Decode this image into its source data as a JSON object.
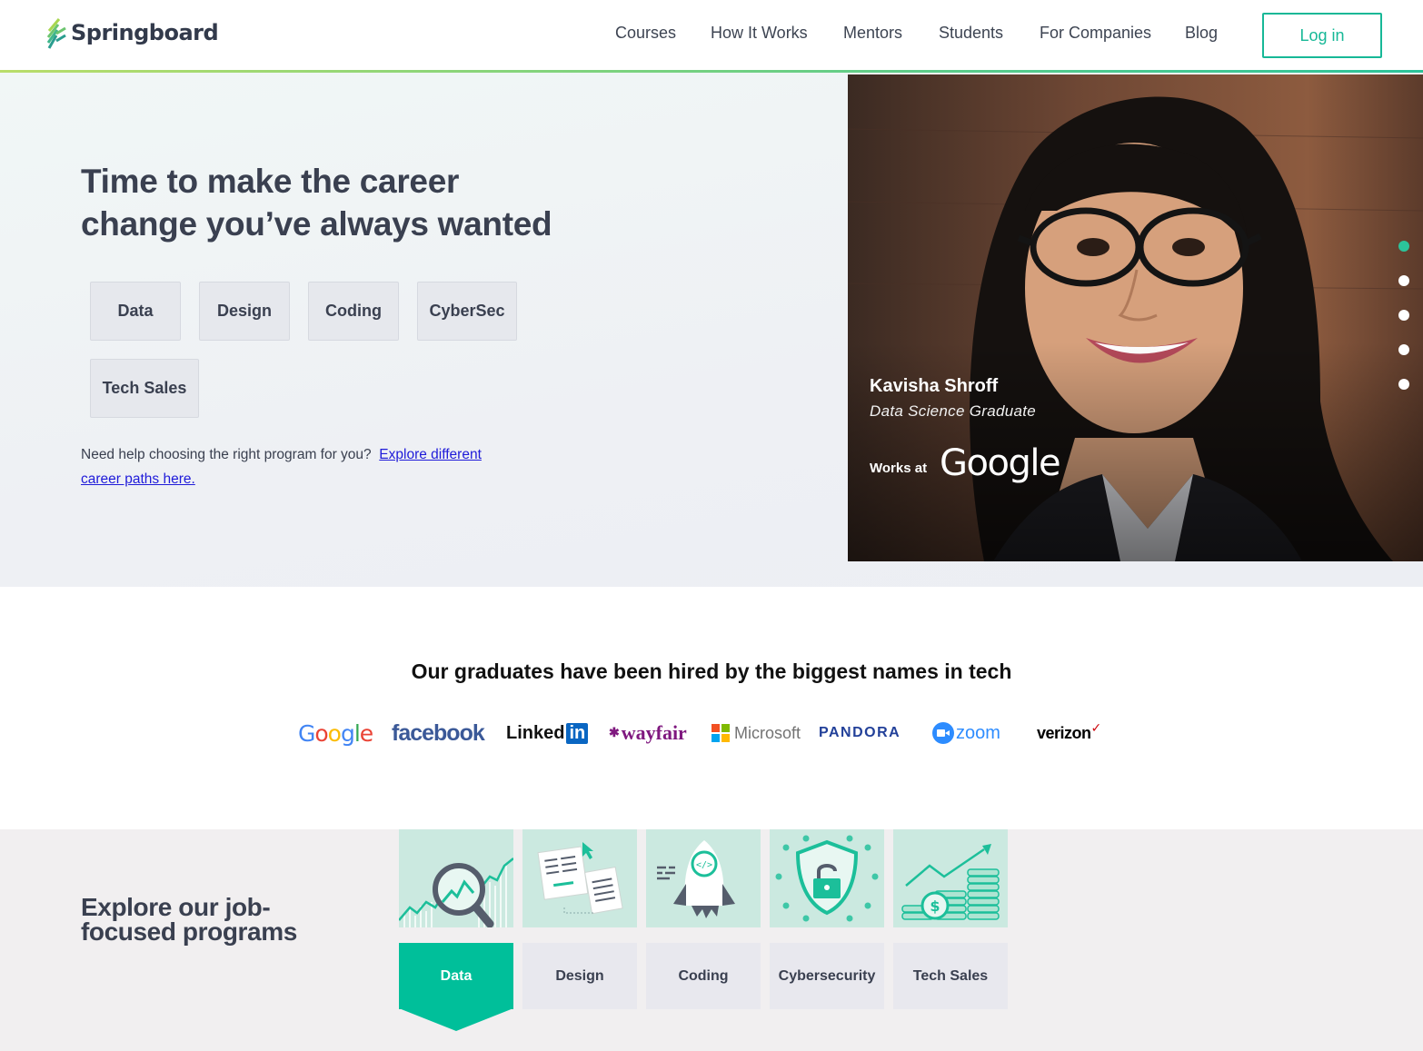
{
  "brand": {
    "name": "Springboard",
    "accent": "#17b897",
    "tab_active": "#00bf9a"
  },
  "nav": {
    "items": [
      "Courses",
      "How It Works",
      "Mentors",
      "Students",
      "For Companies",
      "Blog"
    ],
    "login_label": "Log in"
  },
  "hero": {
    "title": "Time to make the career change you’ve always wanted",
    "categories": [
      "Data",
      "Design",
      "Coding",
      "CyberSec",
      "Tech Sales"
    ],
    "help_text": "Need help choosing the right program for you?",
    "help_link": "Explore different career paths here."
  },
  "testimonial": {
    "name": "Kavisha Shroff",
    "role": "Data Science Graduate",
    "works_at_label": "Works at",
    "company": "Google",
    "slide_count": 5,
    "active_slide": 1
  },
  "hired": {
    "title": "Our graduates have been hired by the biggest names in tech",
    "companies": [
      "Google",
      "facebook",
      "LinkedIn",
      "wayfair",
      "Microsoft",
      "PANDORA",
      "zoom",
      "verizon"
    ]
  },
  "programs": {
    "title": "Explore our job-focused programs",
    "tabs": [
      "Data",
      "Design",
      "Coding",
      "Cybersecurity",
      "Tech Sales"
    ],
    "active_tab": "Data",
    "tile_icons": [
      "magnifier-chart-icon",
      "documents-cursor-icon",
      "rocket-code-icon",
      "shield-lock-icon",
      "growth-coins-icon"
    ]
  }
}
